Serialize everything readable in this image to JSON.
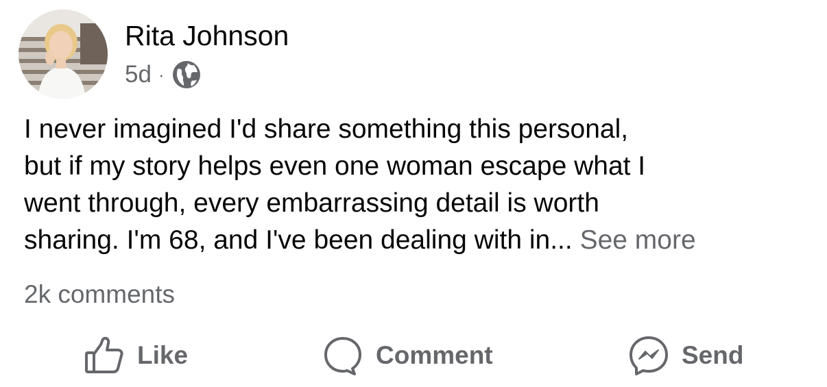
{
  "post": {
    "author": "Rita Johnson",
    "time": "5d",
    "separator": "·",
    "privacy_icon": "globe-icon",
    "body_lines": [
      "I never imagined I'd share something this personal,",
      "but if my story helps even one woman escape what I",
      "went through, every embarrassing detail is worth",
      "sharing. I'm 68, and I've been dealing with in..."
    ],
    "see_more": "See more",
    "comments_count": "2k comments"
  },
  "actions": {
    "like": {
      "label": "Like",
      "icon": "thumbs-up-icon"
    },
    "comment": {
      "label": "Comment",
      "icon": "comment-bubble-icon"
    },
    "send": {
      "label": "Send",
      "icon": "messenger-icon"
    }
  },
  "colors": {
    "primary_text": "#050505",
    "secondary_text": "#65676b",
    "background": "#ffffff"
  }
}
